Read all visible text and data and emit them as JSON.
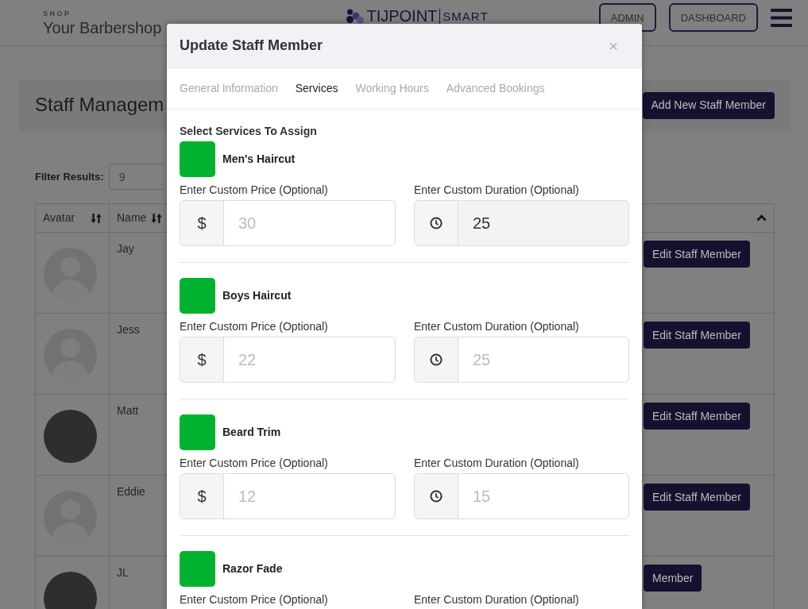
{
  "header": {
    "shop_label": "SHOP",
    "shop_name": "Your Barbershop",
    "brand": "TIJPOINT",
    "brand_suffix": "SMART",
    "buttons": [
      "ADMIN",
      "DASHBOARD"
    ]
  },
  "page": {
    "title": "Staff Managem",
    "add_button": "Add New Staff Member",
    "filter": {
      "label": "Filter Results:",
      "value": "9"
    }
  },
  "table": {
    "columns": [
      "Avatar",
      "Name"
    ],
    "rows": [
      {
        "name": "Jay",
        "kind": "silhouette",
        "button": "Edit Staff Member"
      },
      {
        "name": "Jess",
        "kind": "silhouette",
        "button": "Edit Staff Member"
      },
      {
        "name": "Matt",
        "kind": "photo",
        "button": "Edit Staff Member"
      },
      {
        "name": "Eddie",
        "kind": "silhouette",
        "button": "Edit Staff Member"
      },
      {
        "name": "JL",
        "kind": "photo",
        "button": "Member"
      }
    ]
  },
  "modal": {
    "title": "Update Staff Member",
    "close": "×",
    "tabs": [
      {
        "label": "General Information",
        "selected": false
      },
      {
        "label": "Services",
        "selected": true
      },
      {
        "label": "Working Hours",
        "selected": false
      },
      {
        "label": "Advanced Bookings",
        "selected": false
      }
    ],
    "section_label": "Select Services To Assign",
    "services": [
      {
        "name": "Men's Haircut",
        "selected": true,
        "price": {
          "label": "Enter Custom Price (Optional)",
          "currency": "$",
          "placeholder": "30"
        },
        "duration": {
          "label": "Enter Custom Duration (Optional)",
          "value": "25",
          "focused": true
        }
      },
      {
        "name": "Boys Haircut",
        "selected": true,
        "price": {
          "label": "Enter Custom Price (Optional)",
          "currency": "$",
          "placeholder": "22"
        },
        "duration": {
          "label": "Enter Custom Duration (Optional)",
          "placeholder": "25",
          "focused": false
        }
      },
      {
        "name": "Beard Trim",
        "selected": true,
        "price": {
          "label": "Enter Custom Price (Optional)",
          "currency": "$",
          "placeholder": "12"
        },
        "duration": {
          "label": "Enter Custom Duration (Optional)",
          "placeholder": "15",
          "focused": false
        }
      },
      {
        "name": "Razor Fade",
        "selected": true,
        "price": {
          "label": "Enter Custom Price (Optional)"
        },
        "duration": {
          "label": "Enter Custom Duration (Optional)"
        }
      }
    ]
  }
}
